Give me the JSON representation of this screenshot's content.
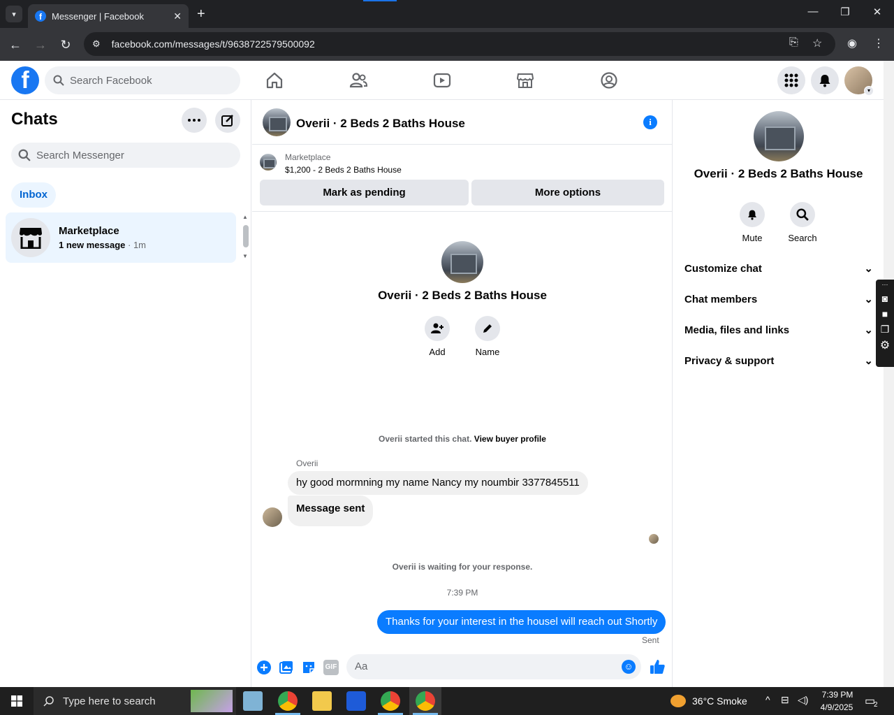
{
  "browser": {
    "tab_title": "Messenger | Facebook",
    "url": "facebook.com/messages/t/9638722579500092"
  },
  "fb": {
    "search_placeholder": "Search Facebook",
    "logo_letter": "f"
  },
  "left": {
    "title": "Chats",
    "search_placeholder": "Search Messenger",
    "inbox_label": "Inbox",
    "chats": [
      {
        "name": "Marketplace",
        "preview": "1 new message",
        "time": "· 1m"
      }
    ]
  },
  "conversation": {
    "title": "Overii · 2 Beds 2 Baths House",
    "marketplace_label": "Marketplace",
    "listing": "$1,200 - 2 Beds 2 Baths House",
    "mark_pending_label": "Mark as pending",
    "more_options_label": "More options",
    "center_name": "Overii · 2 Beds 2 Baths House",
    "add_label": "Add",
    "name_label": "Name",
    "started_text": "Overii started this chat.",
    "view_buyer_profile": "View buyer profile",
    "sender": "Overii",
    "incoming": [
      "hy good mormning my name Nancy  my noumbir 3377845511",
      "Message sent"
    ],
    "waiting_text": "Overii is waiting for your response.",
    "timestamp": "7:39 PM",
    "outgoing": "Thanks for your interest in the housel will reach out Shortly",
    "sent_label": "Sent",
    "composer_placeholder": "Aa",
    "gif_label": "GIF"
  },
  "details": {
    "name": "Overii · 2 Beds 2 Baths House",
    "mute_label": "Mute",
    "search_label": "Search",
    "sections": [
      "Customize chat",
      "Chat members",
      "Media, files and links",
      "Privacy & support"
    ]
  },
  "taskbar": {
    "search_placeholder": "Type here to search",
    "weather": "36°C  Smoke",
    "time": "7:39 PM",
    "date": "4/9/2025",
    "notifications": "2"
  },
  "colors": {
    "brand": "#1877f2",
    "messenger_blue": "#0a7cff",
    "selected_bg": "#ebf5ff"
  }
}
